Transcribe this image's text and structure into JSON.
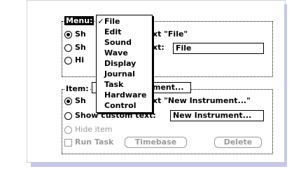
{
  "menu_group": {
    "legend": "Menu:",
    "show_default_text": "xt \"File\"",
    "show_default_prefix": "Sh",
    "show_custom_prefix": "Sh",
    "show_custom_text": "xt:",
    "custom_value": "File",
    "hide_prefix": "Hi"
  },
  "popup_menu": {
    "checkmark": "✓",
    "selected_index": 0,
    "items": [
      "File",
      "Edit",
      "Sound",
      "Wave",
      "Display",
      "Journal",
      "Task",
      "Hardware",
      "Control"
    ]
  },
  "item_group": {
    "legend": "Item:",
    "popup_value": "ment...",
    "show_default_prefix": "Sh",
    "show_default_text": "xt \"New Instrument...\"",
    "show_custom_label": "Show custom text:",
    "custom_value": "New Instrument...",
    "hide_label": "Hide item",
    "run_task_label": "Run Task",
    "timebase_button": "Timebase",
    "delete_button": "Delete"
  }
}
